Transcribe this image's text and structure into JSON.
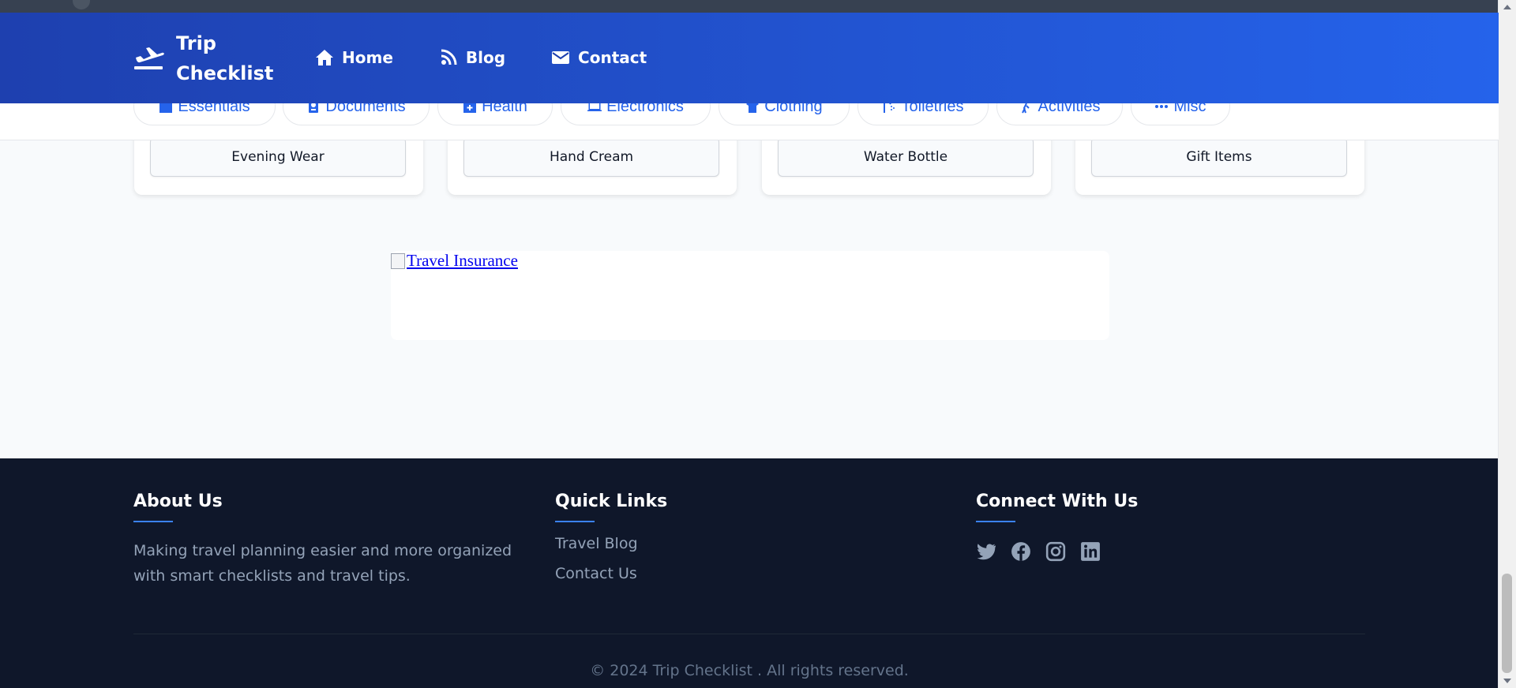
{
  "brand": {
    "line1": "Trip",
    "line2": "Checklist"
  },
  "nav": {
    "home": "Home",
    "blog": "Blog",
    "contact": "Contact"
  },
  "categories": [
    "Essentials",
    "Documents",
    "Health",
    "Electronics",
    "Clothing",
    "Toiletries",
    "Activities",
    "Misc"
  ],
  "cards": [
    "Evening Wear",
    "Hand Cream",
    "Water Bottle",
    "Gift Items"
  ],
  "ad": {
    "alt_text": "Travel Insurance"
  },
  "footer": {
    "about": {
      "title": "About Us",
      "text": "Making travel planning easier and more organized with smart checklists and travel tips."
    },
    "quick": {
      "title": "Quick Links",
      "links": [
        "Travel Blog",
        "Contact Us"
      ]
    },
    "connect": {
      "title": "Connect With Us",
      "icons": [
        "twitter-icon",
        "facebook-icon",
        "instagram-icon",
        "linkedin-icon"
      ]
    },
    "copyright": "© 2024 Trip Checklist . All rights reserved."
  },
  "colors": {
    "primary": "#2563eb",
    "primary_dark": "#1e40af",
    "footer_bg": "#0f172a",
    "accent_line": "#3b82f6"
  }
}
